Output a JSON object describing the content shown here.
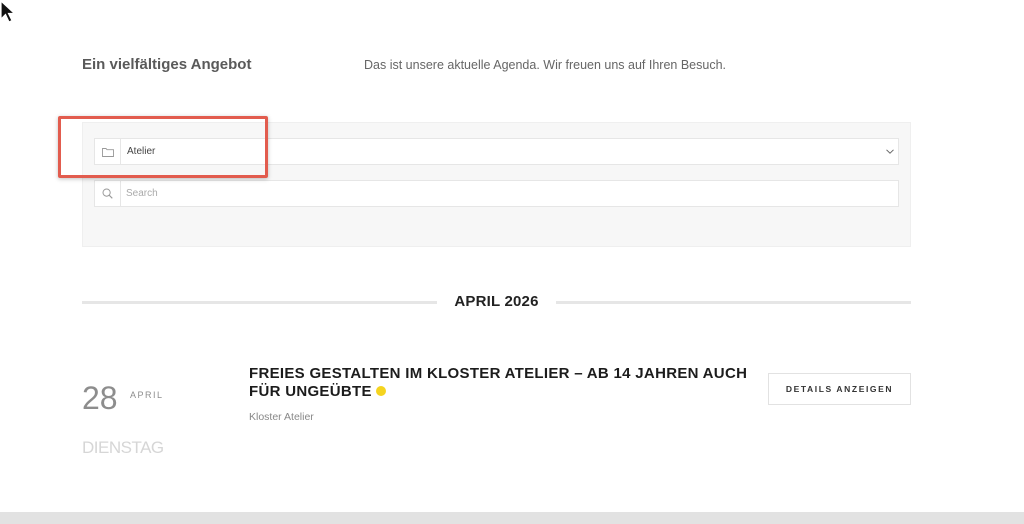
{
  "intro": {
    "title": "Ein vielfältiges Angebot",
    "text": "Das ist unsere aktuelle Agenda. Wir freuen uns auf Ihren Besuch."
  },
  "filters": {
    "category": {
      "value": "Atelier",
      "icon": "folder-icon",
      "chevron": "chevron-down-icon"
    },
    "search": {
      "placeholder": "Search",
      "value": "",
      "icon": "search-icon"
    }
  },
  "colors": {
    "highlight": "#e25c4e",
    "status_dot": "#f5d41f",
    "panel_bg": "#f7f7f7"
  },
  "agenda": {
    "month_heading": "APRIL 2026",
    "events": [
      {
        "day": "28",
        "month": "APRIL",
        "weekday": "DIENSTAG",
        "title": "FREIES GESTALTEN IM KLOSTER ATELIER – AB 14 JAHREN AUCH FÜR UNGEÜBTE",
        "location": "Kloster Atelier",
        "button_label": "DETAILS ANZEIGEN"
      }
    ]
  }
}
